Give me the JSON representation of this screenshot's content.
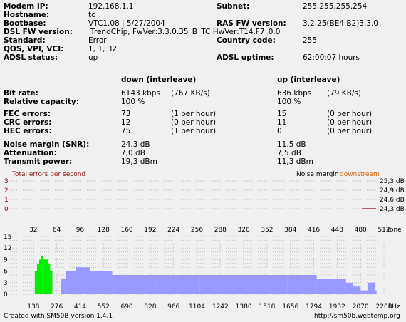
{
  "modem": {
    "labels": {
      "modem_ip": "Modem IP:",
      "hostname": "Hostname:",
      "bootbase": "Bootbase:",
      "dsl_fw": "DSL FW version:",
      "standard": "Standard:",
      "qos": "QOS, VPI, VCI:",
      "adsl_status": "ADSL status:",
      "subnet": "Subnet:",
      "ras_fw": "RAS FW version:",
      "country_code": "Country code:",
      "adsl_uptime": "ADSL uptime:"
    },
    "values": {
      "modem_ip": "192.168.1.1",
      "hostname": "tc",
      "bootbase": "VTC1.08 | 5/27/2004",
      "dsl_fw": "TrendChip, FwVer:3.3.0.35_B_TC HwVer:T14.F7_0.0",
      "standard": "Error",
      "qos": "1, 1, 32",
      "adsl_status": "up",
      "subnet": "255.255.255.254",
      "ras_fw": "3.2.25(BE4.B2)3.3.0",
      "country_code": "255",
      "adsl_uptime": "62:00:07 hours"
    }
  },
  "stats": {
    "down_header": "down (interleave)",
    "up_header": "up (interleave)",
    "rows": [
      {
        "label": "Bit rate:",
        "down": "6143 kbps",
        "down2": "(767 KB/s)",
        "up": "636 kbps",
        "up2": "(79 KB/s)"
      },
      {
        "label": "Relative capacity:",
        "down": "100 %",
        "down2": "",
        "up": "100 %",
        "up2": ""
      },
      {
        "label": "FEC errors:",
        "down": "73",
        "down2": "(1 per hour)",
        "up": "15",
        "up2": "(0 per hour)"
      },
      {
        "label": "CRC errors:",
        "down": "12",
        "down2": "(0 per hour)",
        "up": "11",
        "up2": "(0 per hour)"
      },
      {
        "label": "HEC errors:",
        "down": "75",
        "down2": "(1 per hour)",
        "up": "0",
        "up2": "(0 per hour)"
      },
      {
        "label": "Noise margin (SNR):",
        "down": "24,3 dB",
        "down2": "",
        "up": "11,5 dB",
        "up2": ""
      },
      {
        "label": "Attenuation:",
        "down": "7,0 dB",
        "down2": "",
        "up": "7,5 dB",
        "up2": ""
      },
      {
        "label": "Transmit power:",
        "down": "19,3 dBm",
        "down2": "",
        "up": "11,3 dBm",
        "up2": ""
      }
    ]
  },
  "error_chart": {
    "title": "Total errors per second",
    "legend_noise": "Noise margin",
    "legend_downstream": "downstream",
    "y_ticks": [
      "3",
      "2",
      "1",
      "0"
    ],
    "right_ticks": [
      "25,3 dB",
      "24,9 dB",
      "24,6 dB",
      "24,3 dB"
    ],
    "colors": {
      "title": "#8b1a1a",
      "downstream": "#d2691e",
      "trace": "#8b0000"
    }
  },
  "chart_data": {
    "type": "bar",
    "title": "",
    "xlabel": "kHz",
    "top_axis_label": "Tone",
    "top_ticks": [
      "32",
      "64",
      "96",
      "128",
      "160",
      "192",
      "224",
      "256",
      "288",
      "320",
      "352",
      "384",
      "416",
      "448",
      "480",
      "512"
    ],
    "bottom_ticks": [
      "138",
      "276",
      "414",
      "552",
      "690",
      "828",
      "966",
      "1104",
      "1242",
      "1380",
      "1518",
      "1656",
      "1794",
      "1932",
      "2070",
      "2208"
    ],
    "y_ticks": [
      "15",
      "12",
      "9",
      "6",
      "3",
      "0"
    ],
    "ylim": [
      0,
      15
    ],
    "xlim_tones": [
      0,
      512
    ],
    "grid": true,
    "series": [
      {
        "color": "#00ee00",
        "segments": [
          [
            34,
            6
          ],
          [
            37,
            8
          ],
          [
            40,
            9
          ],
          [
            43,
            10
          ],
          [
            46,
            9
          ],
          [
            49,
            9
          ],
          [
            52,
            8
          ],
          [
            55,
            6
          ]
        ]
      },
      {
        "color": "#9999ff",
        "segments": [
          [
            70,
            4
          ],
          [
            76,
            6
          ],
          [
            90,
            7
          ],
          [
            110,
            6
          ],
          [
            140,
            5
          ],
          [
            200,
            5
          ],
          [
            260,
            5
          ],
          [
            320,
            5
          ],
          [
            380,
            5
          ],
          [
            420,
            4
          ],
          [
            450,
            4
          ],
          [
            460,
            3
          ],
          [
            470,
            2
          ],
          [
            480,
            1
          ],
          [
            490,
            3
          ],
          [
            500,
            1
          ]
        ]
      }
    ]
  },
  "footer": {
    "left": "Created with  SM50B version 1.4.1",
    "right": "http://sm50b.webtemp.org"
  }
}
